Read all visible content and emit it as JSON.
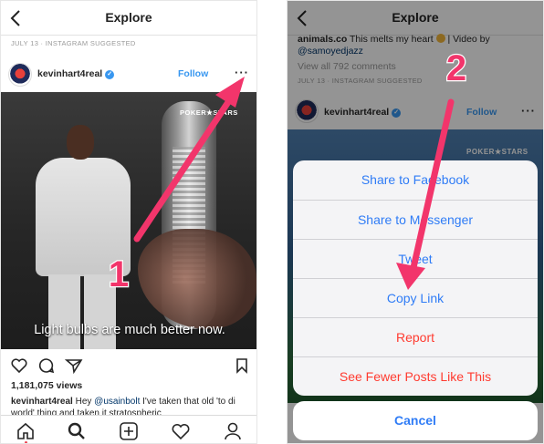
{
  "colors": {
    "link_blue": "#3897f0",
    "ios_blue": "#2f7cf6",
    "danger_red": "#ff3b30",
    "annotation_pink": "#f2356b"
  },
  "left_screen": {
    "header": {
      "title": "Explore",
      "back_icon": "chevron-left-icon"
    },
    "suggested_label": "JULY 13 · INSTAGRAM SUGGESTED",
    "post": {
      "username": "kevinhart4real",
      "follow_label": "Follow",
      "more_label": "···",
      "watermark": "POKER★STARS",
      "video_caption": "Light bulbs are much better now.",
      "views": "1,181,075 views",
      "caption_user": "kevinhart4real",
      "caption_text_1": " Hey ",
      "caption_mention": "@usainbolt",
      "caption_text_2": " I've taken that old 'to di world' thing and taken it stratospheric"
    },
    "actions": [
      "heart-icon",
      "comment-icon",
      "share-icon",
      "bookmark-icon"
    ],
    "tabs": [
      "home-icon",
      "search-icon",
      "add-icon",
      "activity-icon",
      "profile-icon"
    ]
  },
  "right_screen": {
    "header": {
      "title": "Explore",
      "back_icon": "chevron-left-icon"
    },
    "prev_caption_user": "animals.co",
    "prev_caption_text": " This melts my heart ",
    "prev_caption_tail": " | Video by",
    "prev_caption_mention": "@samoyedjazz",
    "view_all": "View all 792 comments",
    "suggested_label": "JULY 13 · INSTAGRAM SUGGESTED",
    "post": {
      "username": "kevinhart4real",
      "follow_label": "Follow",
      "more_label": "···",
      "watermark": "POKER★STARS"
    },
    "menu": [
      {
        "label": "Share to Facebook"
      },
      {
        "label": "Share to Messenger"
      },
      {
        "label": "Tweet"
      },
      {
        "label": "Copy Link"
      },
      {
        "label": "Report"
      },
      {
        "label": "See Fewer Posts Like This"
      }
    ],
    "cancel_label": "Cancel"
  },
  "annotations": {
    "step1": "1",
    "step2": "2"
  }
}
